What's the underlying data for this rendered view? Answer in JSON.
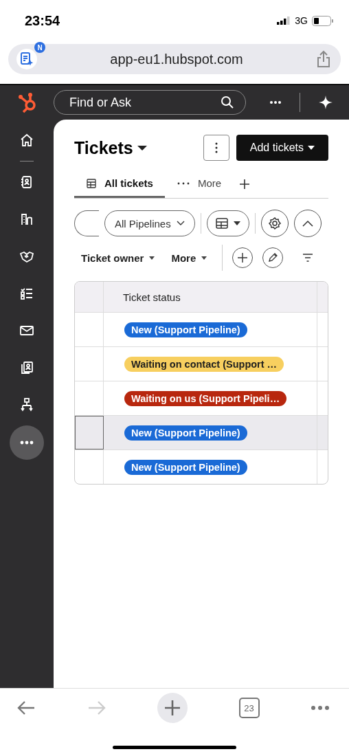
{
  "status_bar": {
    "time": "23:54",
    "network": "3G"
  },
  "browser": {
    "url": "app-eu1.hubspot.com",
    "badge": "N",
    "tab_count": "23"
  },
  "topbar": {
    "search": {
      "placeholder": "Find or Ask"
    }
  },
  "page": {
    "title": "Tickets",
    "add_button": "Add tickets"
  },
  "tabs": [
    {
      "label": "All tickets",
      "selected": true
    },
    {
      "label": "More",
      "selected": false
    }
  ],
  "filters": {
    "pipeline": "All Pipelines",
    "quick": [
      "Ticket owner",
      "More"
    ]
  },
  "table": {
    "columns": [
      "Ticket status"
    ],
    "rows": [
      {
        "status": "New (Support Pipeline)",
        "color": "#1a6ad6",
        "selected": false
      },
      {
        "status": "Waiting on contact (Support …",
        "color": "#f7cf5f",
        "selected": false
      },
      {
        "status": "Waiting on us (Support Pipeli…",
        "color": "#b8270e",
        "selected": false
      },
      {
        "status": "New (Support Pipeline)",
        "color": "#1a6ad6",
        "selected": true
      },
      {
        "status": "New (Support Pipeline)",
        "color": "#1a6ad6",
        "selected": false
      }
    ]
  }
}
